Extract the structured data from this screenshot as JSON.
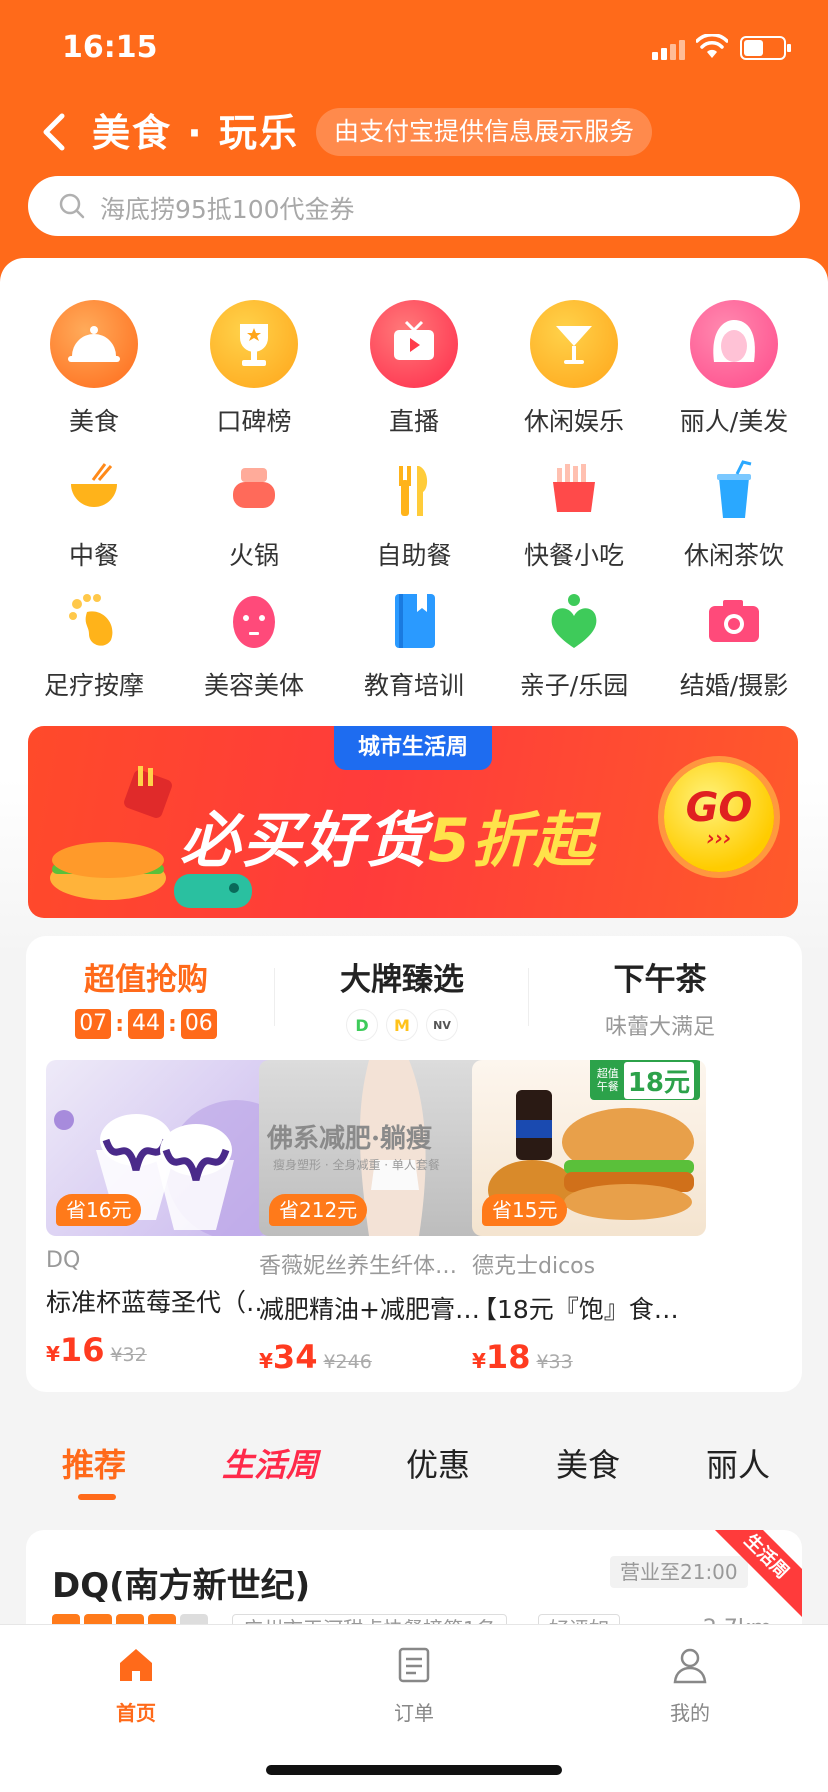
{
  "status_bar": {
    "time": "16:15",
    "battery_level": 0.5
  },
  "header": {
    "title": "美食 · 玩乐",
    "info_pill": "由支付宝提供信息展示服务",
    "search_placeholder": "海底捞95抵100代金券"
  },
  "categories_primary": [
    {
      "label": "美食",
      "icon": "cloche-icon",
      "color": "#ff7a1a"
    },
    {
      "label": "口碑榜",
      "icon": "trophy-icon",
      "color": "#ffa51a"
    },
    {
      "label": "直播",
      "icon": "tv-icon",
      "color": "#ff3b4a"
    },
    {
      "label": "休闲娱乐",
      "icon": "cocktail-icon",
      "color": "#ffb31a"
    },
    {
      "label": "丽人/美发",
      "icon": "woman-hair-icon",
      "color": "#ff4a8a"
    }
  ],
  "categories_secondary": [
    {
      "label": "中餐",
      "icon": "rice-bowl-icon",
      "color": "#ffb31a"
    },
    {
      "label": "火锅",
      "icon": "hotpot-icon",
      "color": "#ff5a4a"
    },
    {
      "label": "自助餐",
      "icon": "fork-knife-icon",
      "color": "#ffb31a"
    },
    {
      "label": "快餐小吃",
      "icon": "fries-icon",
      "color": "#ff4a4a"
    },
    {
      "label": "休闲茶饮",
      "icon": "cup-icon",
      "color": "#2aa8ff"
    },
    {
      "label": "足疗按摩",
      "icon": "foot-icon",
      "color": "#ffb31a"
    },
    {
      "label": "美容美体",
      "icon": "face-mask-icon",
      "color": "#ff4a7a"
    },
    {
      "label": "教育培训",
      "icon": "book-icon",
      "color": "#2a9aff"
    },
    {
      "label": "亲子/乐园",
      "icon": "family-heart-icon",
      "color": "#3ecb5a"
    },
    {
      "label": "结婚/摄影",
      "icon": "camera-icon",
      "color": "#ff4a7a"
    }
  ],
  "banner": {
    "tag": "城市生活周",
    "main_prefix": "必买好货",
    "main_highlight": "5折起",
    "go_label": "GO",
    "go_arrows": "›››"
  },
  "deals": {
    "col1": {
      "title": "超值抢购",
      "timer": [
        "07",
        "44",
        "06"
      ]
    },
    "col2": {
      "title": "大牌臻选",
      "brands": [
        "D",
        "M",
        "NV"
      ]
    },
    "col3": {
      "title": "下午茶",
      "subtitle": "味蕾大满足"
    },
    "products": [
      {
        "badge": "省16元",
        "shop": "DQ",
        "name": "标准杯蓝莓圣代（…",
        "price_symbol": "¥",
        "price": "16",
        "original": "¥32"
      },
      {
        "badge": "省212元",
        "shop": "香薇妮丝养生纤体…",
        "name": "减肥精油+减肥膏…",
        "price_symbol": "¥",
        "price": "34",
        "original": "¥246",
        "img_text": "佛系减肥·躺瘦",
        "img_sub": "瘦身塑形 · 全身减重 · 单人套餐"
      },
      {
        "badge": "省15元",
        "shop": "德克士dicos",
        "name": "【18元『饱』食…",
        "price_symbol": "¥",
        "price": "18",
        "original": "¥33",
        "img_tag_small": "超值午餐",
        "img_tag_big": "18元"
      }
    ]
  },
  "tabs": [
    "推荐",
    "生活周",
    "优惠",
    "美食",
    "丽人"
  ],
  "store": {
    "name": "DQ(南方新世纪)",
    "hours": "营业至21:00",
    "ribbon": "生活周",
    "rating_stars": 4,
    "tag1": "广州市天河甜点快餐榜第1名",
    "tag2": "好评如",
    "distance": "2.7km"
  },
  "bottom_nav": [
    {
      "label": "首页",
      "icon": "home-icon",
      "active": true
    },
    {
      "label": "订单",
      "icon": "order-list-icon",
      "active": false
    },
    {
      "label": "我的",
      "icon": "profile-icon",
      "active": false
    }
  ],
  "colors": {
    "brand": "#ff6a1a",
    "price": "#ff3b20",
    "special_tab": "#ff2a4a"
  }
}
